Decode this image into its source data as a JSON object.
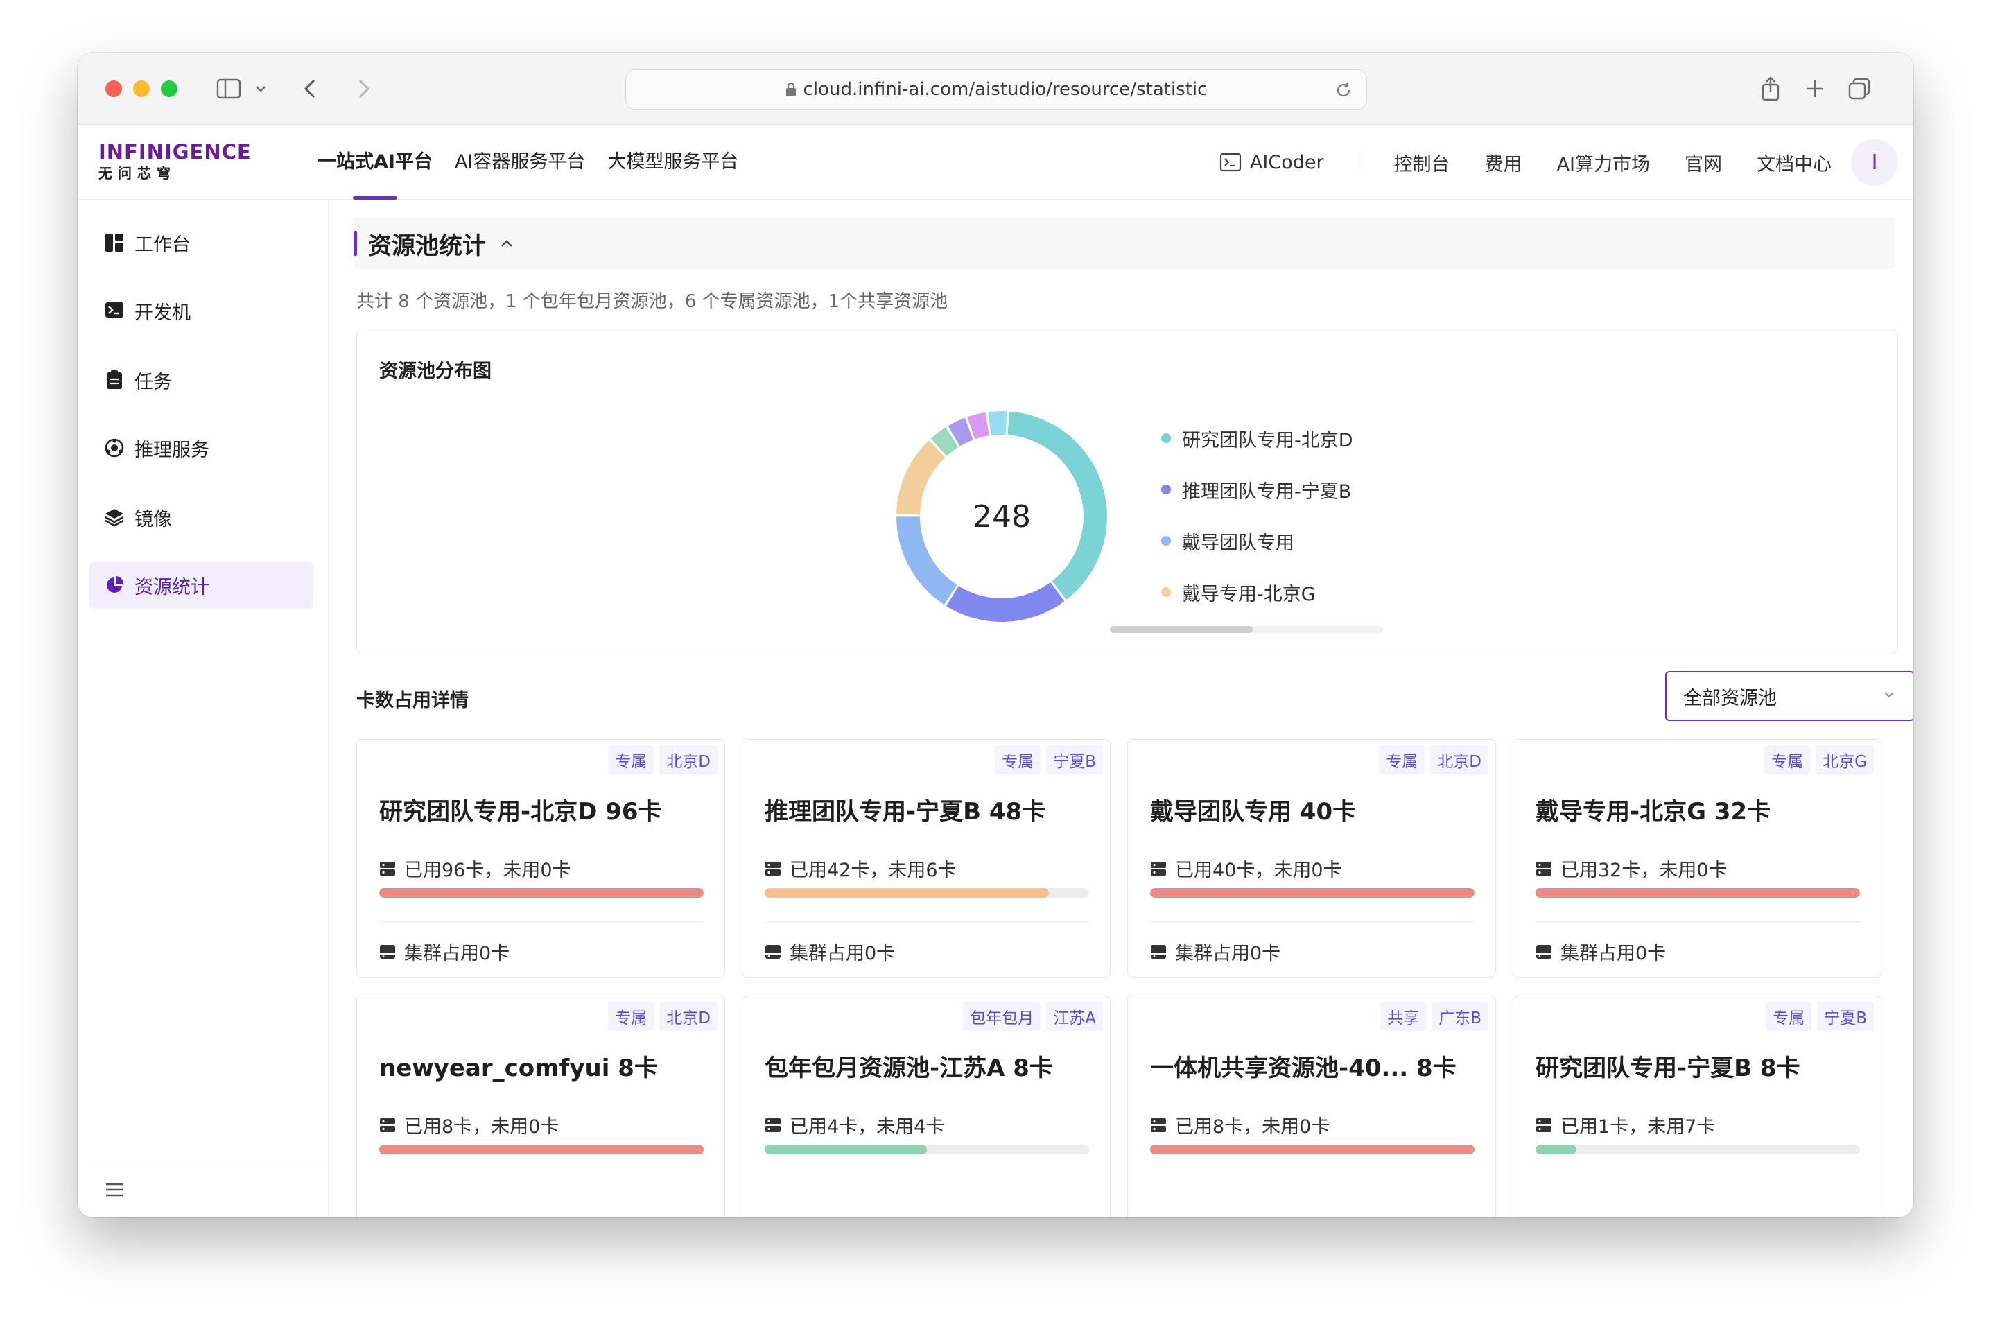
{
  "browser": {
    "url": "cloud.infini-ai.com/aistudio/resource/statistic"
  },
  "brand": {
    "logo_top": "INFINIGENCE",
    "logo_bottom": "无问芯穹",
    "accent": "#6c2bd9"
  },
  "platform_nav": [
    {
      "label": "一站式AI平台",
      "active": true
    },
    {
      "label": "AI容器服务平台",
      "active": false
    },
    {
      "label": "大模型服务平台",
      "active": false
    }
  ],
  "right_nav": {
    "aicoder": "AICoder",
    "console": "控制台",
    "billing": "费用",
    "market": "AI算力市场",
    "site": "官网",
    "docs": "文档中心",
    "avatar": "I"
  },
  "sidebar": {
    "items": [
      {
        "label": "工作台",
        "icon": "dashboard-icon",
        "active": false
      },
      {
        "label": "开发机",
        "icon": "terminal-icon",
        "active": false
      },
      {
        "label": "任务",
        "icon": "task-icon",
        "active": false
      },
      {
        "label": "推理服务",
        "icon": "inference-icon",
        "active": false
      },
      {
        "label": "镜像",
        "icon": "layers-icon",
        "active": false
      },
      {
        "label": "资源统计",
        "icon": "pie-icon",
        "active": true
      }
    ]
  },
  "section": {
    "title": "资源池统计",
    "summary": "共计 8 个资源池，1 个包年包月资源池，6 个专属资源池，1个共享资源池"
  },
  "distribution": {
    "title": "资源池分布图",
    "total": "248"
  },
  "chart_data": {
    "type": "pie",
    "total": 248,
    "slices": [
      {
        "name": "研究团队专用-北京D",
        "value": 96,
        "color": "#7bd3d6"
      },
      {
        "name": "推理团队专用-宁夏B",
        "value": 48,
        "color": "#8088ef"
      },
      {
        "name": "戴导团队专用",
        "value": 40,
        "color": "#8fb7f2"
      },
      {
        "name": "戴导专用-北京G",
        "value": 32,
        "color": "#f2cf9a"
      },
      {
        "name": "newyear_comfyui",
        "value": 8,
        "color": "#9cd8c0"
      },
      {
        "name": "包年包月资源池-江苏A",
        "value": 8,
        "color": "#a79af0"
      },
      {
        "name": "一体机共享资源池-40...",
        "value": 8,
        "color": "#d79af0"
      },
      {
        "name": "研究团队专用-宁夏B",
        "value": 8,
        "color": "#97dcef"
      }
    ],
    "legend_visible": [
      "研究团队专用-北京D",
      "推理团队专用-宁夏B",
      "戴导团队专用",
      "戴导专用-北京G"
    ]
  },
  "cards_section": {
    "title": "卡数占用详情",
    "filter_value": "全部资源池"
  },
  "cards": [
    {
      "title": "研究团队专用-北京D 96卡",
      "tags": [
        "专属",
        "北京D"
      ],
      "usage": "已用96卡，未用0卡",
      "used_ratio": 1.0,
      "bar_color": "#ec8a87",
      "cluster": "集群占用0卡"
    },
    {
      "title": "推理团队专用-宁夏B 48卡",
      "tags": [
        "专属",
        "宁夏B"
      ],
      "usage": "已用42卡，未用6卡",
      "used_ratio": 0.875,
      "bar_color": "#f5c08a",
      "cluster": "集群占用0卡"
    },
    {
      "title": "戴导团队专用 40卡",
      "tags": [
        "专属",
        "北京D"
      ],
      "usage": "已用40卡，未用0卡",
      "used_ratio": 1.0,
      "bar_color": "#ec8a87",
      "cluster": "集群占用0卡"
    },
    {
      "title": "戴导专用-北京G 32卡",
      "tags": [
        "专属",
        "北京G"
      ],
      "usage": "已用32卡，未用0卡",
      "used_ratio": 1.0,
      "bar_color": "#ec8a87",
      "cluster": "集群占用0卡"
    },
    {
      "title": "newyear_comfyui 8卡",
      "tags": [
        "专属",
        "北京D"
      ],
      "usage": "已用8卡，未用0卡",
      "used_ratio": 1.0,
      "bar_color": "#ec8a87",
      "cluster": ""
    },
    {
      "title": "包年包月资源池-江苏A 8卡",
      "tags": [
        "包年包月",
        "江苏A"
      ],
      "usage": "已用4卡，未用4卡",
      "used_ratio": 0.5,
      "bar_color": "#8fd3b6",
      "cluster": ""
    },
    {
      "title": "一体机共享资源池-40... 8卡",
      "tags": [
        "共享",
        "广东B"
      ],
      "usage": "已用8卡，未用0卡",
      "used_ratio": 1.0,
      "bar_color": "#ec8a87",
      "cluster": ""
    },
    {
      "title": "研究团队专用-宁夏B 8卡",
      "tags": [
        "专属",
        "宁夏B"
      ],
      "usage": "已用1卡，未用7卡",
      "used_ratio": 0.125,
      "bar_color": "#8fd3b6",
      "cluster": ""
    }
  ]
}
